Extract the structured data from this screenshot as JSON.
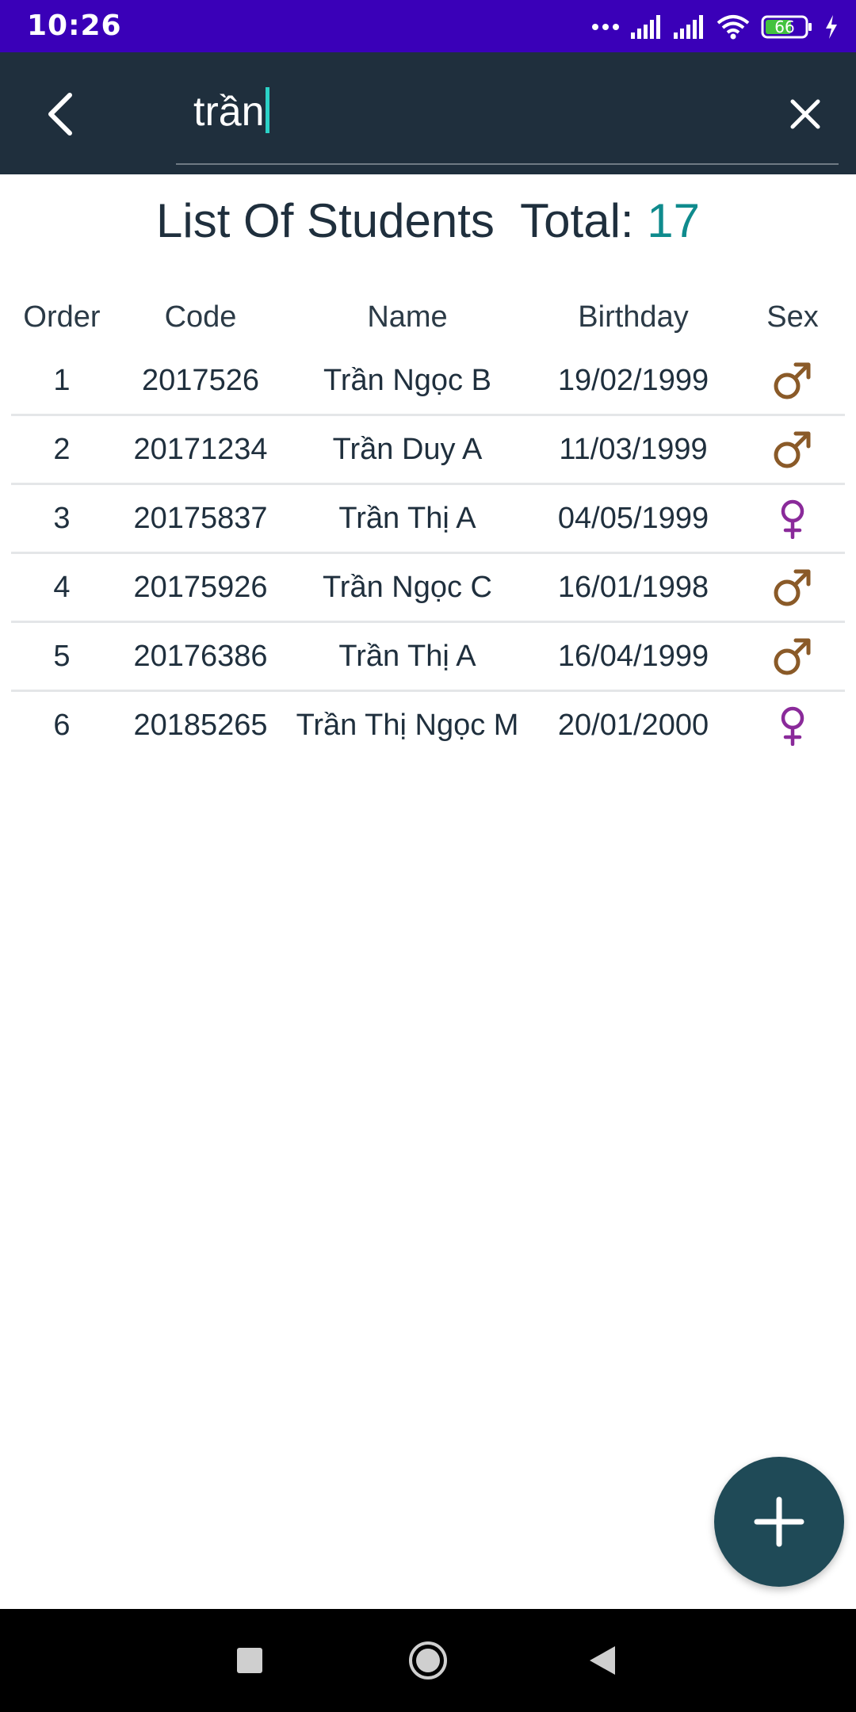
{
  "status_bar": {
    "time": "10:26",
    "battery_level": "66",
    "icons": [
      "more-dots-icon",
      "signal-icon",
      "signal-icon",
      "wifi-icon",
      "battery-icon",
      "charging-icon"
    ]
  },
  "app_bar": {
    "search_value": "trần",
    "back_icon": "back-arrow-icon",
    "clear_icon": "close-icon"
  },
  "list": {
    "title_label": "List Of Students",
    "total_label": "Total:",
    "total_value": "17"
  },
  "table": {
    "headers": {
      "order": "Order",
      "code": "Code",
      "name": "Name",
      "birthday": "Birthday",
      "sex": "Sex"
    },
    "rows": [
      {
        "order": "1",
        "code": "2017526",
        "name": "Trần Ngọc B",
        "birthday": "19/02/1999",
        "sex": "male"
      },
      {
        "order": "2",
        "code": "20171234",
        "name": "Trần Duy A",
        "birthday": "11/03/1999",
        "sex": "male"
      },
      {
        "order": "3",
        "code": "20175837",
        "name": "Trần Thị A",
        "birthday": "04/05/1999",
        "sex": "female"
      },
      {
        "order": "4",
        "code": "20175926",
        "name": "Trần Ngọc C",
        "birthday": "16/01/1998",
        "sex": "male"
      },
      {
        "order": "5",
        "code": "20176386",
        "name": "Trần Thị A",
        "birthday": "16/04/1999",
        "sex": "male"
      },
      {
        "order": "6",
        "code": "20185265",
        "name": "Trần Thị Ngọc M",
        "birthday": "20/01/2000",
        "sex": "female"
      }
    ]
  },
  "fab": {
    "icon": "plus-icon"
  },
  "nav_bar": {
    "icons": [
      "recents-square-icon",
      "home-circle-icon",
      "back-triangle-icon"
    ]
  },
  "colors": {
    "status_bar": "#3a00b8",
    "app_bar": "#1f2f3d",
    "accent_total": "#0f8b8d",
    "cursor": "#2bd2c7",
    "male_icon": "#8a5a28",
    "female_icon": "#8a2a9a",
    "fab": "#1f4a57"
  }
}
